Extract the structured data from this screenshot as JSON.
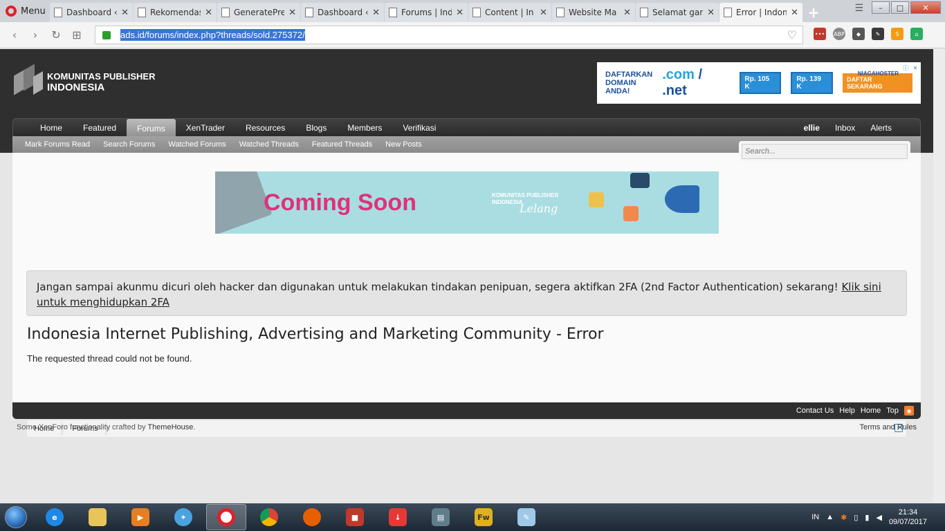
{
  "browser": {
    "menu_label": "Menu",
    "tabs": [
      {
        "label": "Dashboard ‹"
      },
      {
        "label": "Rekomendas"
      },
      {
        "label": "GeneratePre"
      },
      {
        "label": "Dashboard ‹"
      },
      {
        "label": "Forums | Ind"
      },
      {
        "label": "Content | In"
      },
      {
        "label": "Website Ma"
      },
      {
        "label": "Selamat gan"
      },
      {
        "label": "Error | Indon"
      }
    ],
    "url": "ads.id/forums/index.php?threads/sold.275372/"
  },
  "site": {
    "logo_line1": "KOMUNITAS PUBLISHER",
    "logo_line2": "INDONESIA",
    "ad": {
      "headline1": "DAFTARKAN",
      "headline2": "DOMAIN",
      "headline3": "ANDA!",
      "com": ".com",
      "net": ".net",
      "price_com": "Rp. 105 K",
      "price_net": "Rp. 139 K",
      "brand": "NIAGAHOSTER",
      "cta": "DAFTAR SEKARANG"
    },
    "nav": {
      "tabs": [
        "Home",
        "Featured",
        "Forums",
        "XenTrader",
        "Resources",
        "Blogs",
        "Members",
        "Verifikasi"
      ],
      "active": "Forums",
      "user": "ellie",
      "inbox": "Inbox",
      "alerts": "Alerts"
    },
    "subnav": [
      "Mark Forums Read",
      "Search Forums",
      "Watched Forums",
      "Watched Threads",
      "Featured Threads",
      "New Posts"
    ],
    "search_placeholder": "Search...",
    "banner": {
      "text": "Coming Soon",
      "logo_line1": "KOMUNITAS PUBLISHER",
      "logo_line2": "INDONESIA",
      "script": "Lelang"
    },
    "breadcrumb": [
      "Home",
      "Forums"
    ],
    "notice_text": "Jangan sampai akunmu dicuri oleh hacker dan digunakan untuk melakukan tindakan penipuan, segera aktifkan 2FA (2nd Factor Authentication) sekarang! ",
    "notice_link": "Klik sini untuk menghidupkan 2FA",
    "page_title": "Indonesia Internet Publishing, Advertising and Marketing Community - Error",
    "error_message": "The requested thread could not be found.",
    "footer_links": [
      "Contact Us",
      "Help",
      "Home",
      "Top"
    ],
    "credit_prefix": "Some XenForo functionality crafted by ",
    "credit_link": "ThemeHouse",
    "credit_suffix": ".",
    "terms": "Terms and Rules"
  },
  "taskbar": {
    "lang": "IN",
    "time": "21:34",
    "date": "09/07/2017"
  },
  "colors": {
    "accent_pink": "#e0317a",
    "header_dark": "#2f2f2f",
    "url_highlight": "#3875d7"
  }
}
